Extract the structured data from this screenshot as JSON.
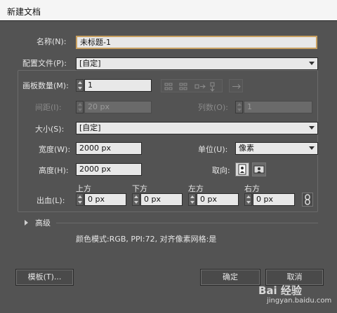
{
  "dialog": {
    "title": "新建文档"
  },
  "name": {
    "label": "名称(N):",
    "value": "未标题-1"
  },
  "profile": {
    "label": "配置文件(P):",
    "value": "[自定]"
  },
  "artboards": {
    "label": "画板数量(M):",
    "value": "1"
  },
  "spacing": {
    "label": "间距(I):",
    "value": "20 px"
  },
  "columns": {
    "label": "列数(O):",
    "value": "1"
  },
  "size": {
    "label": "大小(S):",
    "value": "[自定]"
  },
  "width": {
    "label": "宽度(W):",
    "value": "2000 px"
  },
  "units": {
    "label": "单位(U):",
    "value": "像素"
  },
  "height": {
    "label": "高度(H):",
    "value": "2000 px"
  },
  "orientation": {
    "label": "取向:",
    "selected": "portrait"
  },
  "bleed": {
    "label": "出血(L):",
    "top": {
      "label": "上方",
      "value": "0 px"
    },
    "bottom": {
      "label": "下方",
      "value": "0 px"
    },
    "left": {
      "label": "左方",
      "value": "0 px"
    },
    "right": {
      "label": "右方",
      "value": "0 px"
    }
  },
  "advanced": {
    "label": "高级"
  },
  "info": {
    "text": "颜色模式:RGB, PPI:72, 对齐像素网格:是"
  },
  "buttons": {
    "templates": "模板(T)...",
    "ok": "确定",
    "cancel": "取消"
  },
  "watermark": {
    "text": "Bai 经验",
    "url": "jingyan.baidu.com"
  },
  "icons": {
    "artboard_layout": [
      "grid-by-row-icon",
      "grid-by-column-icon",
      "arrange-by-row-icon",
      "arrange-by-column-icon",
      "right-to-left-icon"
    ],
    "link": "chain-link-icon"
  },
  "colors": {
    "background": "#535353",
    "field": "#e8e8e8",
    "accent_border": "#c8a060"
  }
}
